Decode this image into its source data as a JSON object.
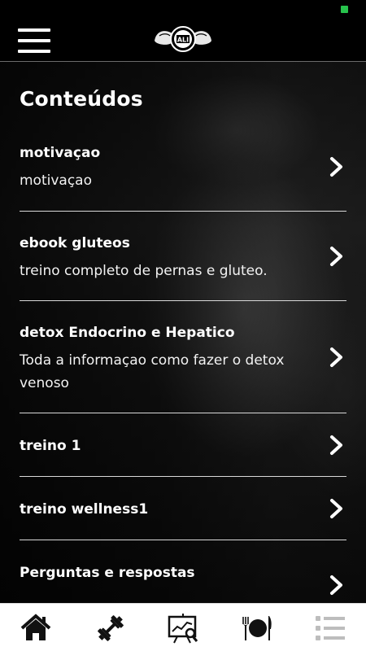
{
  "header": {
    "logo_text": "ALI"
  },
  "page": {
    "section_title": "Conteúdos"
  },
  "items": [
    {
      "title": "motivaçao",
      "subtitle": "motivaçao"
    },
    {
      "title": "ebook gluteos",
      "subtitle": "treino completo de pernas e gluteo."
    },
    {
      "title": "detox Endocrino e Hepatico",
      "subtitle_line1": "Toda a informaçao como fazer o detox",
      "subtitle_line2": "venoso"
    },
    {
      "title": "treino 1"
    },
    {
      "title": "treino wellness1"
    },
    {
      "title": "Perguntas e respostas"
    }
  ],
  "bottom_nav": [
    {
      "icon": "home-icon",
      "active": true
    },
    {
      "icon": "dumbbell-icon",
      "active": true
    },
    {
      "icon": "chart-presentation-icon",
      "active": true
    },
    {
      "icon": "plate-cutlery-icon",
      "active": true
    },
    {
      "icon": "list-icon",
      "active": false
    }
  ],
  "colors": {
    "status_indicator": "#27c24c",
    "nav_active": "#111111",
    "nav_inactive": "#bdbdbd"
  }
}
